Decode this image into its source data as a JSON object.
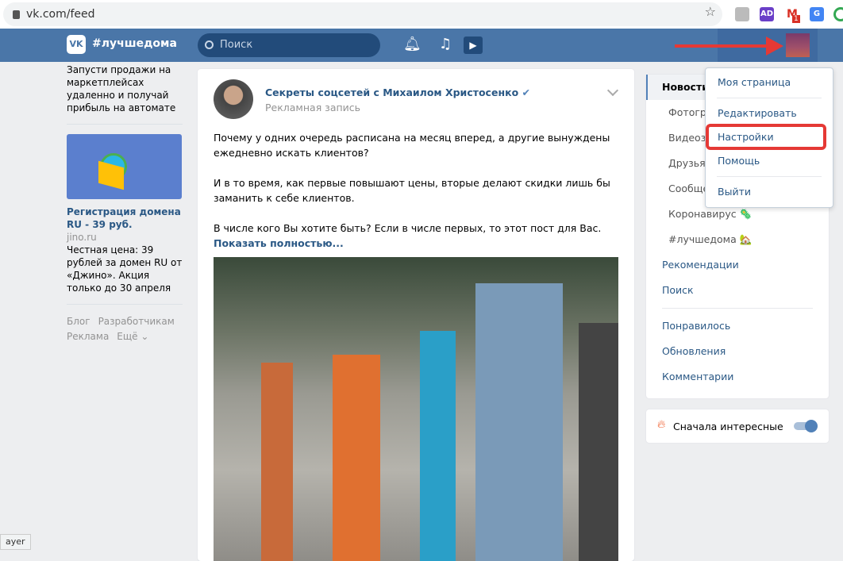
{
  "browser": {
    "url": "vk.com/feed",
    "gmail_badge": "1",
    "status_tip": "ayer"
  },
  "header": {
    "hashtag": "#лучшедома",
    "search_placeholder": "Поиск",
    "logo": "VK"
  },
  "left": {
    "promo_text": "Запусти продажи на маркетплейсах удаленно и получай прибыль на автомате",
    "ad": {
      "title": "Регистрация домена RU - 39 руб.",
      "domain": "jino.ru",
      "text": "Честная цена: 39 рублей за домен RU от «Джино». Акция только до 30 апреля"
    },
    "footer": [
      "Блог",
      "Разработчикам",
      "Реклама",
      "Ещё ⌄"
    ]
  },
  "post": {
    "author": "Секреты соцсетей с Михаилом Христосенко",
    "verified": "✔",
    "subtitle": "Рекламная запись",
    "paragraphs": [
      "Почему у одних очередь расписана на месяц вперед, а другие вынуждены ежедневно искать клиентов?",
      "И в то время, как первые повышают цены, вторые делают скидки лишь бы заманить к себе клиентов.",
      "В числе кого Вы хотите быть? Если в числе первых, то этот пост для Вас."
    ],
    "show_more": "Показать полностью..."
  },
  "nav": {
    "active": "Новости",
    "subs": [
      "Фотографии",
      "Видеозаписи",
      "Друзья",
      "Сообщества",
      "Коронавирус 🦠",
      "#лучшедома 🏡"
    ],
    "items1": [
      "Рекомендации",
      "Поиск"
    ],
    "items2": [
      "Понравилось",
      "Обновления",
      "Комментарии"
    ]
  },
  "toggle": {
    "label": "Сначала интересные",
    "on": true
  },
  "menu": {
    "items": [
      "Моя страница",
      "Редактировать",
      "Настройки",
      "Помощь",
      "Выйти"
    ],
    "highlighted": "Настройки"
  },
  "colors": {
    "brand": "#4a76a8",
    "link": "#2a5885",
    "highlight": "#e53935"
  }
}
